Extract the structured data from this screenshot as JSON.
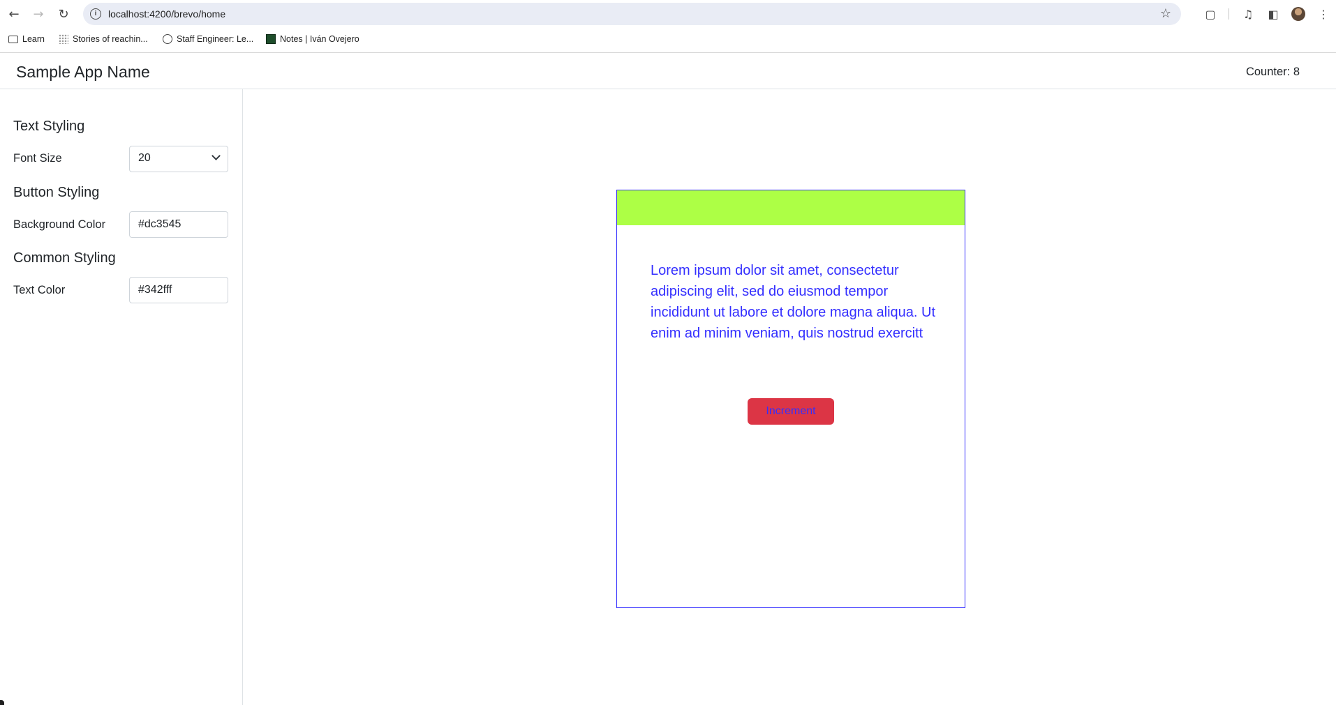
{
  "browser": {
    "url": "localhost:4200/brevo/home",
    "icons": {
      "back": "arrow-left-icon",
      "forward": "arrow-right-icon",
      "reload": "reload-icon",
      "info": "info-icon",
      "star": "star-icon",
      "extensions": "puzzle-icon",
      "media": "media-control-icon",
      "side_panel": "side-panel-icon",
      "menu": "kebab-menu-icon"
    },
    "bookmarks": [
      {
        "label": "Learn",
        "icon": "folder-icon"
      },
      {
        "label": "Stories of reachin...",
        "icon": "dots-icon"
      },
      {
        "label": "Staff Engineer: Le...",
        "icon": "globe-icon"
      },
      {
        "label": "Notes | Iván Ovejero",
        "icon": "notes-icon"
      }
    ]
  },
  "app": {
    "title": "Sample App Name",
    "counter_label": "Counter: 8"
  },
  "sidebar": {
    "text_styling": {
      "heading": "Text Styling",
      "font_size_label": "Font Size",
      "font_size_value": "20"
    },
    "button_styling": {
      "heading": "Button Styling",
      "background_color_label": "Background Color",
      "background_color_value": "#dc3545"
    },
    "common_styling": {
      "heading": "Common Styling",
      "text_color_label": "Text Color",
      "text_color_value": "#342fff"
    }
  },
  "preview": {
    "paragraph": "Lorem ipsum dolor sit amet, consectetur adipiscing elit, sed do eiusmod tempor incididunt ut labore et dolore magna aliqua. Ut enim ad minim veniam, quis nostrud exercitt",
    "button_label": "Increment"
  },
  "colors": {
    "banner": "#adff45",
    "text": "#342fff",
    "button_background": "#dc3545",
    "border": "#342fff"
  }
}
